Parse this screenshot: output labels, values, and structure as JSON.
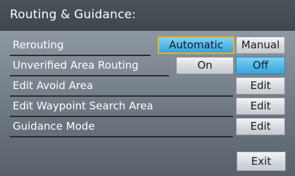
{
  "screen": {
    "title": "Routing & Guidance:"
  },
  "rows": [
    {
      "label": "Rerouting",
      "options": [
        "Automatic",
        "Manual"
      ]
    },
    {
      "label": "Unverified Area Routing",
      "options": [
        "On",
        "Off"
      ]
    },
    {
      "label": "Edit Avoid Area",
      "button": "Edit"
    },
    {
      "label": "Edit Waypoint Search Area",
      "button": "Edit"
    },
    {
      "label": "Guidance Mode",
      "button": "Edit"
    }
  ],
  "exit_label": "Exit",
  "state": {
    "rerouting_selected": "Automatic",
    "unverified_area_routing_selected": "Off",
    "focused_option": "Automatic"
  },
  "colors": {
    "selected_option": "#4eb6e8",
    "focus_outline": "#f0b220",
    "title_bar": "#434b53"
  }
}
